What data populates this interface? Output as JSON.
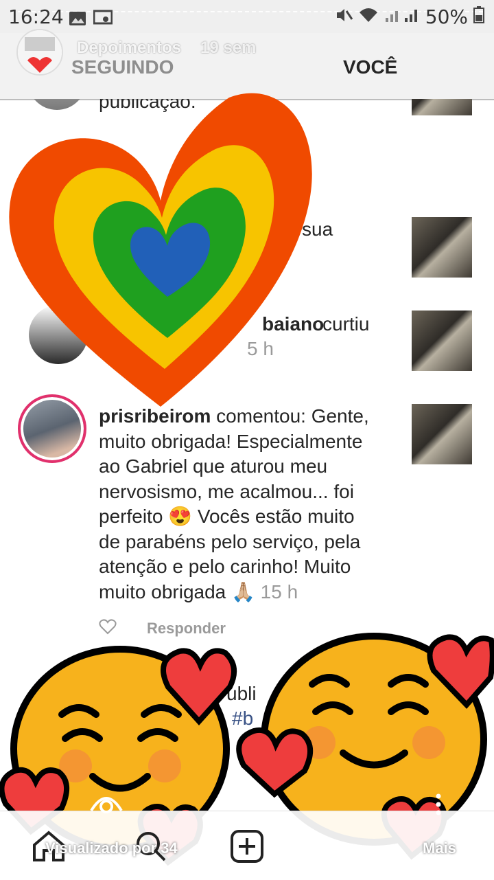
{
  "status_bar": {
    "time": "16:24",
    "battery": "50%",
    "icons": [
      "image-icon",
      "cast-icon",
      "mute-icon",
      "wifi-icon",
      "signal-icon",
      "battery-icon"
    ]
  },
  "story": {
    "title": "Depoimentos",
    "age": "19 sem",
    "viewed_by": "Visualizado por 34",
    "more": "Mais"
  },
  "tabs": {
    "following": "SEGUINDO",
    "you": "VOCÊ"
  },
  "feed": {
    "partial_top": "publicação.",
    "partial_sua": "sua",
    "like_row": {
      "username_fragment": "baiano",
      "action": "curtiu",
      "time_fragment": "5 h"
    },
    "comment": {
      "username": "prisribeirom",
      "action": "comentou:",
      "text_lines": [
        "Gente,",
        "muito obrigada! Especialmente",
        "ao Gabriel que aturou meu",
        "nervosismo, me acalmou... foi",
        "perfeito 😍 Vocês estão muito",
        "de parabéns pelo serviço, pela",
        "atenção e pelo carinho! Muito",
        "muito obrigada 🙏🏼"
      ],
      "time": "15 h",
      "reply": "Responder"
    },
    "partial_bottom": {
      "line1": "ubli",
      "line2": "#b"
    }
  },
  "colors": {
    "heart_outer": "#f04a00",
    "heart_yellow": "#f7c400",
    "heart_green": "#1fa01f",
    "heart_blue": "#2160b8",
    "comment_ring": "#e1306c",
    "emoji_face": "#f7b21c",
    "emoji_heart": "#ee3d3d"
  }
}
